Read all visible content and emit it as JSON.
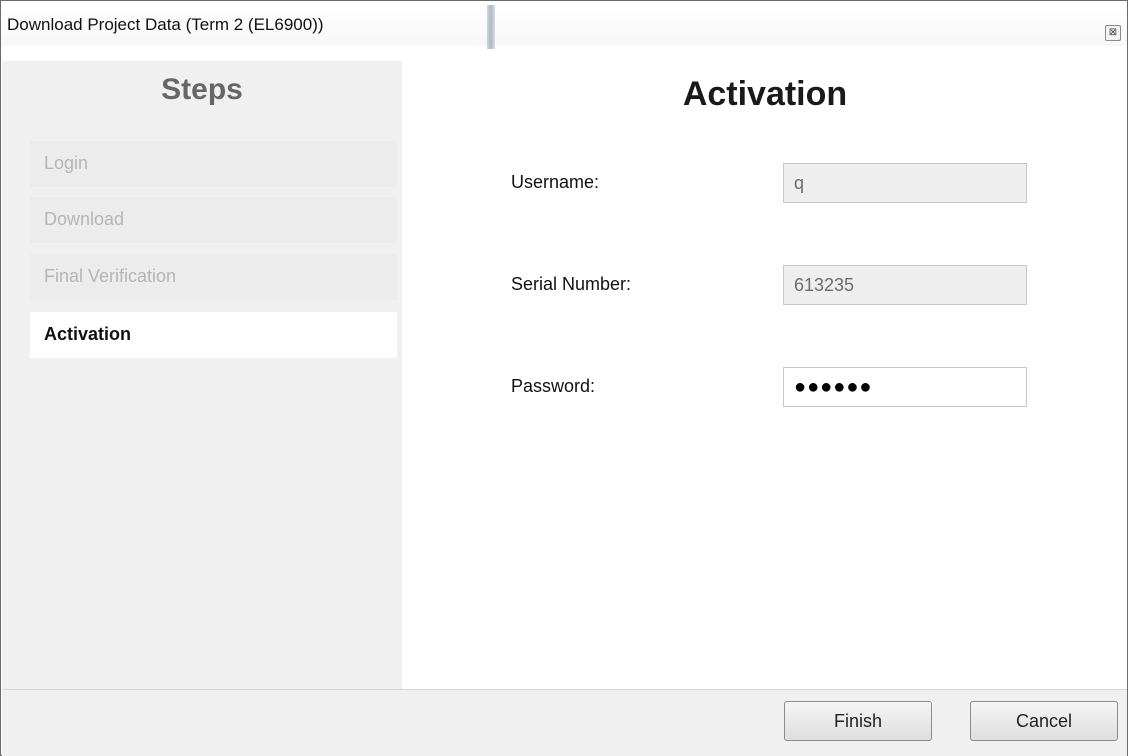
{
  "window": {
    "title": "Download Project Data (Term 2 (EL6900))",
    "close_glyph": "⊠"
  },
  "sidebar": {
    "title": "Steps",
    "items": [
      {
        "label": "Login",
        "state": "completed"
      },
      {
        "label": "Download",
        "state": "completed"
      },
      {
        "label": "Final Verification",
        "state": "completed"
      },
      {
        "label": "Activation",
        "state": "active"
      }
    ]
  },
  "main": {
    "title": "Activation",
    "fields": {
      "username": {
        "label": "Username:",
        "value": "q"
      },
      "serial": {
        "label": "Serial Number:",
        "value": "613235"
      },
      "password": {
        "label": "Password:",
        "value": "●●●●●●"
      }
    }
  },
  "footer": {
    "finish_label": "Finish",
    "cancel_label": "Cancel"
  },
  "colors": {
    "sidebar_bg": "#f0f0f0",
    "step_inactive_text": "#b5b5b5",
    "step_active_bg": "#ffffff",
    "readonly_field_bg": "#eeeeee"
  }
}
